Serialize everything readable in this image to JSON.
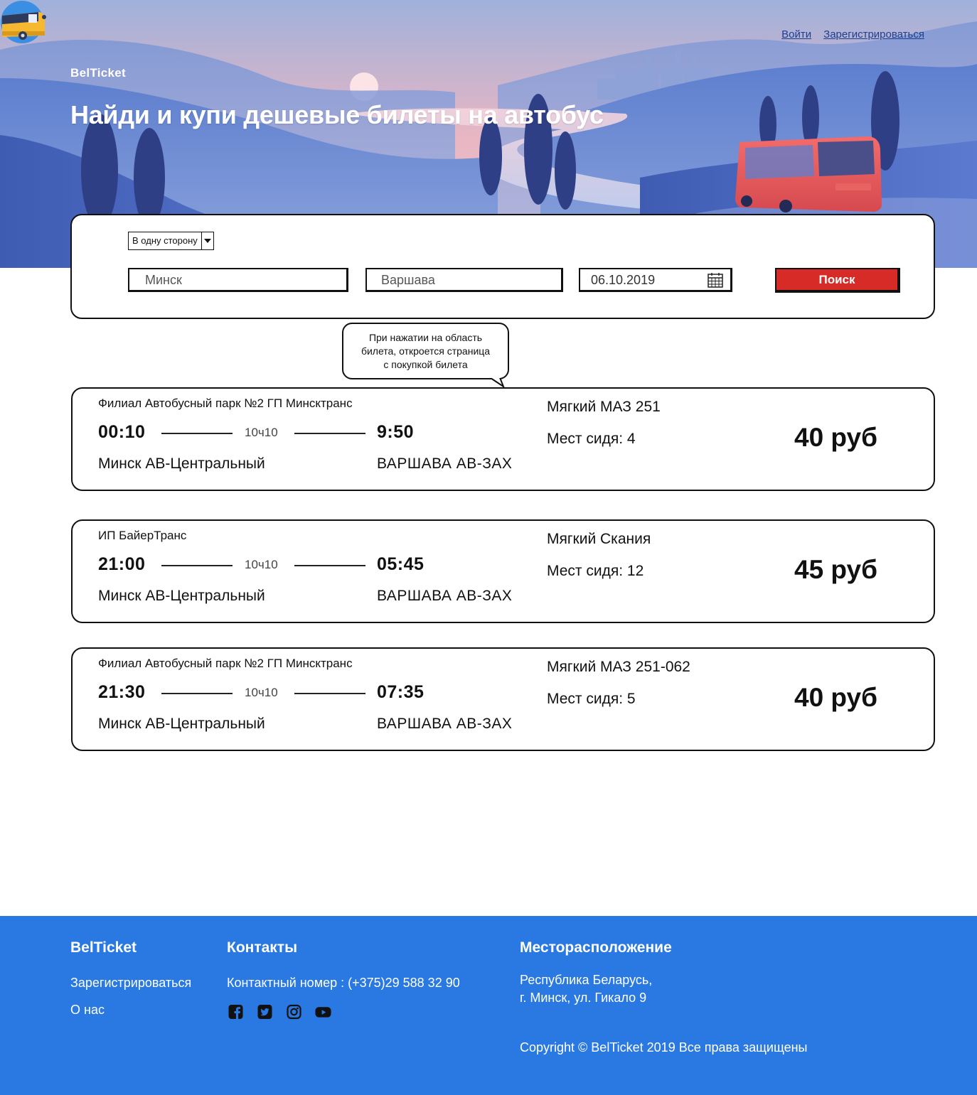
{
  "header": {
    "brand": "BelTicket",
    "login": "Войти",
    "register": "Зарегистрироваться",
    "title": "Найди и купи дешевые билеты на автобус"
  },
  "search": {
    "trip_type": "В одну сторону",
    "from": "Минск",
    "to": "Варшава",
    "date": "06.10.2019",
    "button": "Поиск"
  },
  "tooltip": {
    "line1": "При нажатии на область",
    "line2": "билета, откроется страница",
    "line3": "с покупкой билета"
  },
  "tickets": [
    {
      "carrier": "Филиал Автобусный парк №2 ГП Минсктранс",
      "dep_time": "00:10",
      "duration": "10ч10",
      "arr_time": "9:50",
      "dep_station": "Минск АВ-Центральный",
      "arr_station": "ВАРШАВА АВ-ЗАХ",
      "bus": "Мягкий МАЗ 251",
      "seats": "Мест сидя: 4",
      "price": "40 руб"
    },
    {
      "carrier": "ИП БайерТранс",
      "dep_time": "21:00",
      "duration": "10ч10",
      "arr_time": "05:45",
      "dep_station": "Минск АВ-Центральный",
      "arr_station": "ВАРШАВА АВ-ЗАХ",
      "bus": "Мягкий Скания",
      "seats": "Мест сидя: 12",
      "price": "45 руб"
    },
    {
      "carrier": "Филиал Автобусный парк №2 ГП Минсктранс",
      "dep_time": "21:30",
      "duration": "10ч10",
      "arr_time": "07:35",
      "dep_station": "Минск АВ-Центральный",
      "arr_station": "ВАРШАВА АВ-ЗАХ",
      "bus": "Мягкий МАЗ 251-062",
      "seats": "Мест сидя: 5",
      "price": "40 руб"
    }
  ],
  "footer": {
    "brand": "BelTicket",
    "register": "Зарегистрироваться",
    "about": "О нас",
    "contacts_title": "Контакты",
    "phone": "Контактный номер : (+375)29 588 32 90",
    "location_title": "Месторасположение",
    "address_line1": "Республика Беларусь,",
    "address_line2": "г. Минск, ул. Гикало 9",
    "copyright": "Copyright © BelTicket 2019 Все права защищены",
    "social_icons": [
      "facebook-icon",
      "twitter-icon",
      "instagram-icon",
      "youtube-icon"
    ]
  },
  "colors": {
    "footer_bg": "#2a79e3",
    "search_button": "#d72b27",
    "link": "#1d3f8f"
  }
}
